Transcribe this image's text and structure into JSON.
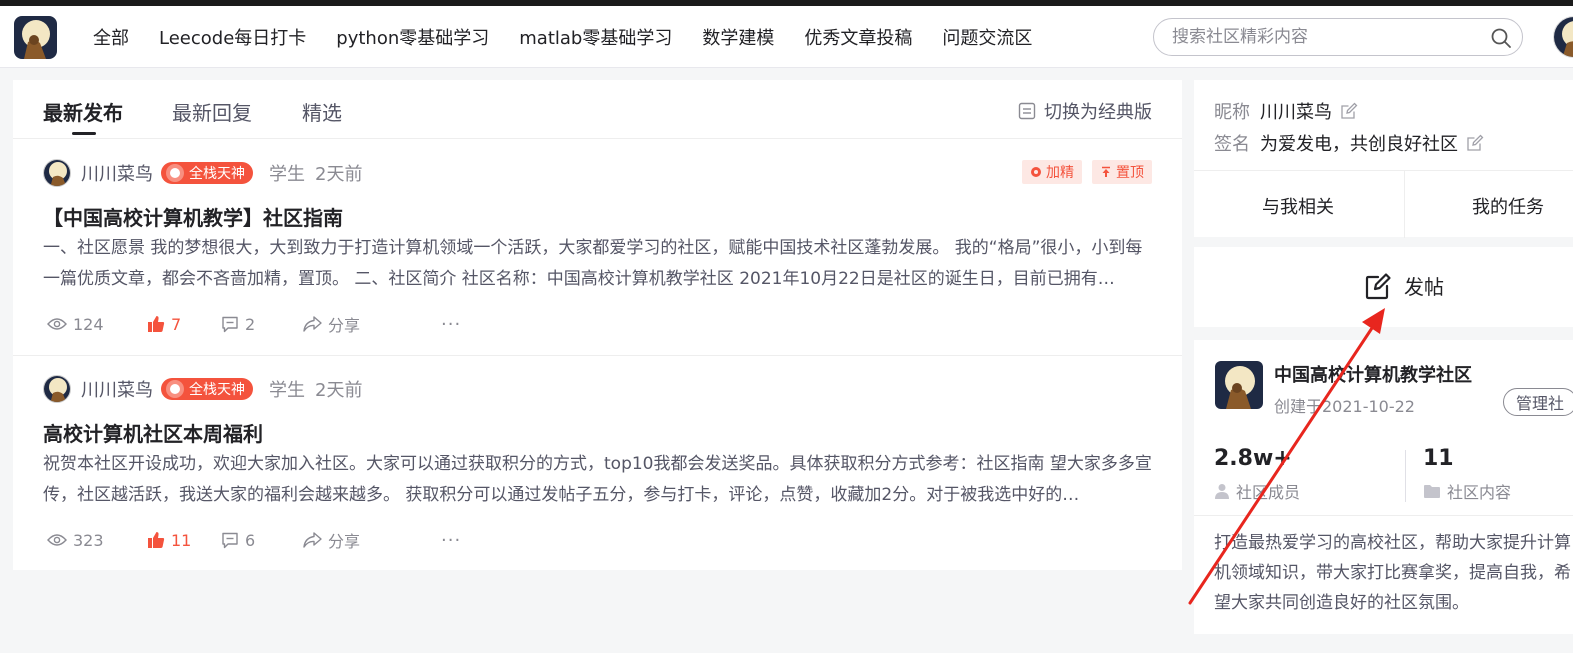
{
  "nav": {
    "items": [
      "全部",
      "Leecode每日打卡",
      "python零基础学习",
      "matlab零基础学习",
      "数学建模",
      "优秀文章投稿",
      "问题交流区"
    ],
    "search_placeholder": "搜索社区精彩内容"
  },
  "feed": {
    "tabs": [
      "最新发布",
      "最新回复",
      "精选"
    ],
    "switch_label": "切换为经典版",
    "posts": [
      {
        "author": "川川菜鸟",
        "badge": "全栈天神",
        "role": "学生",
        "time": "2天前",
        "tags": [
          "加精",
          "置顶"
        ],
        "title": "【中国高校计算机教学】社区指南",
        "desc": "一、社区愿景 我的梦想很大，大到致力于打造计算机领域一个活跃，大家都爱学习的社区，赋能中国技术社区蓬勃发展。 我的“格局”很小，小到每一篇优质文章，都会不吝啬加精，置顶。 二、社区简介 社区名称：中国高校计算机教学社区 2021年10月22日是社区的诞生日，目前已拥有…",
        "views": "124",
        "likes": "7",
        "comments": "2",
        "share": "分享"
      },
      {
        "author": "川川菜鸟",
        "badge": "全栈天神",
        "role": "学生",
        "time": "2天前",
        "tags": [],
        "title": "高校计算机社区本周福利",
        "desc": "祝贺本社区开设成功，欢迎大家加入社区。大家可以通过获取积分的方式，top10我都会发送奖品。具体获取积分方式参考：社区指南 望大家多多宣传，社区越活跃，我送大家的福利会越来越多。 获取积分可以通过发帖子五分，参与打卡，评论，点赞，收藏加2分。对于被我选中好的…",
        "views": "323",
        "likes": "11",
        "comments": "6",
        "share": "分享"
      }
    ]
  },
  "profile": {
    "nickname_label": "昵称",
    "nickname": "川川菜鸟",
    "sign_label": "签名",
    "sign": "为爱发电，共创良好社区",
    "tabs": [
      "与我相关",
      "我的任务"
    ]
  },
  "post_button": "发帖",
  "community": {
    "name": "中国高校计算机教学社区",
    "created": "创建于2021-10-22",
    "manage": "管理社",
    "members_num": "2.8w+",
    "members_label": "社区成员",
    "content_num": "11",
    "content_label": "社区内容",
    "desc": "打造最热爱学习的高校社区，帮助大家提升计算机领域知识，带大家打比赛拿奖，提高自我，希望大家共同创造良好的社区氛围。"
  },
  "colors": {
    "accent": "#f4533d",
    "nav_indicator": "#e33e33"
  },
  "icons": [
    "search-icon",
    "eye-icon",
    "thumb-up-icon",
    "comment-icon",
    "share-icon",
    "more-icon",
    "edit-icon",
    "post-icon",
    "user-icon",
    "folder-icon",
    "switch-icon",
    "flame-icon",
    "pin-icon"
  ]
}
